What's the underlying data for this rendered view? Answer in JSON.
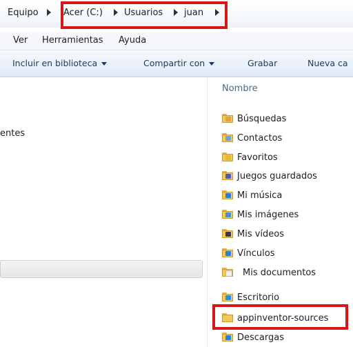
{
  "address_bar": {
    "crumbs": [
      "Equipo",
      "Acer (C:)",
      "Usuarios",
      "juan"
    ]
  },
  "menu": {
    "items": [
      "Ver",
      "Herramientas",
      "Ayuda"
    ]
  },
  "toolbar": {
    "include_label": "Incluir en biblioteca",
    "share_label": "Compartir con",
    "burn_label": "Grabar",
    "new_folder_label": "Nueva ca"
  },
  "nav_pane": {
    "truncated_item": "entes"
  },
  "file_list": {
    "column_header": "Nombre",
    "items": [
      {
        "name": "Búsquedas",
        "icon": "search-folder-icon"
      },
      {
        "name": "Contactos",
        "icon": "contacts-folder-icon"
      },
      {
        "name": "Favoritos",
        "icon": "favorites-folder-icon"
      },
      {
        "name": "Juegos guardados",
        "icon": "games-folder-icon"
      },
      {
        "name": "Mi música",
        "icon": "music-folder-icon"
      },
      {
        "name": "Mis imágenes",
        "icon": "pictures-folder-icon"
      },
      {
        "name": "Mis vídeos",
        "icon": "videos-folder-icon"
      },
      {
        "name": "Vínculos",
        "icon": "links-folder-icon"
      },
      {
        "name": "Mis documentos",
        "icon": "documents-folder-icon"
      },
      {
        "name": "Escritorio",
        "icon": "desktop-folder-icon"
      },
      {
        "name": "appinventor-sources",
        "icon": "folder-icon"
      },
      {
        "name": "Descargas",
        "icon": "downloads-folder-icon"
      }
    ]
  },
  "colors": {
    "highlight": "#d21919",
    "folder": "#f1c85b",
    "toolbar_text": "#1c3a5e"
  }
}
